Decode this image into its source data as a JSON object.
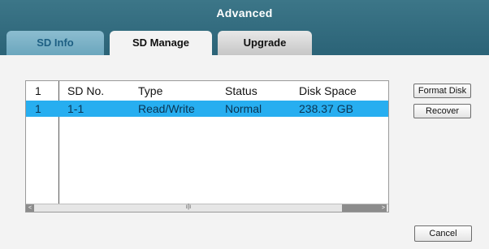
{
  "window": {
    "title": "Advanced"
  },
  "tabs": [
    {
      "label": "SD Info"
    },
    {
      "label": "SD Manage"
    },
    {
      "label": "Upgrade"
    }
  ],
  "table": {
    "header": [
      "1",
      "SD No.",
      "Type",
      "Status",
      "Disk Space"
    ],
    "rows": [
      [
        "1",
        "1-1",
        "Read/Write",
        "Normal",
        "238.37 GB"
      ]
    ]
  },
  "scrollbar": {
    "left_arrow": "<",
    "right_arrow": ">",
    "grip": "ı|ı"
  },
  "buttons": {
    "format_disk": "Format Disk",
    "recover": "Recover",
    "cancel": "Cancel"
  },
  "colors": {
    "titlebar": "#2f697d",
    "selected_row": "#27aef0",
    "active_tab_text": "#111111",
    "inactive_tab_sdinfo": "#7fb3c8"
  }
}
